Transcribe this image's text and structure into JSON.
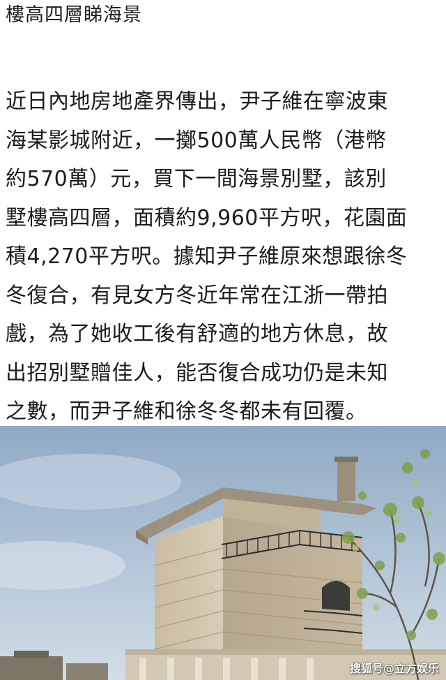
{
  "headline": "樓高四層睇海景",
  "article": {
    "lines": [
      "近日內地房地產界傳出，尹子維在寧波東",
      "海某影城附近，一擲500萬人民幣（港幣",
      "約570萬）元，買下一間海景別墅，該別",
      "墅樓高四層，面積約9,960平方呎，花園面",
      "積4,270平方呎。據知尹子維原來想跟徐冬",
      "冬復合，有見女方冬近年常在江浙一帶拍",
      "戲，為了她收工後有舒適的地方休息，故",
      "出招別墅贈佳人，能否復合成功仍是未知",
      "之數，而尹子維和徐冬冬都未有回覆。"
    ]
  },
  "photo": {
    "watermark": "搜狐号@立方娱乐"
  }
}
